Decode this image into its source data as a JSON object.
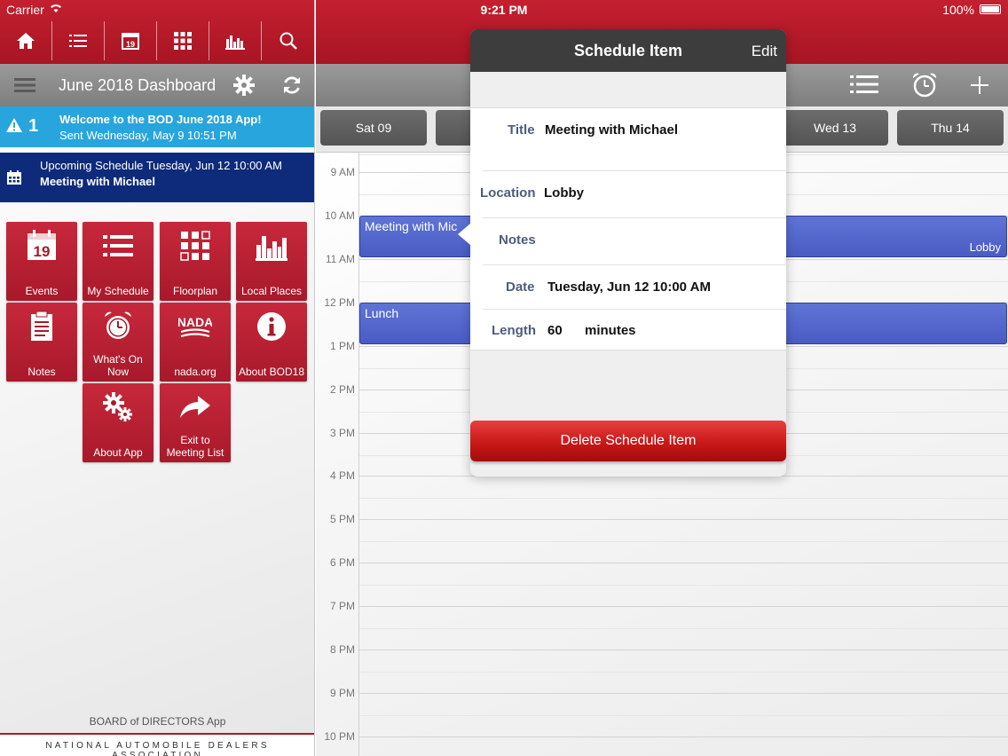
{
  "status_bar": {
    "carrier": "Carrier",
    "time": "9:21 PM",
    "battery": "100%"
  },
  "toolbar": {
    "icons": [
      "home-icon",
      "list-icon",
      "calendar-icon",
      "floorplan-grid-icon",
      "city-skyline-icon",
      "search-icon"
    ]
  },
  "dashboard": {
    "title": "June 2018 Dashboard"
  },
  "notification": {
    "count": "1",
    "title": "Welcome to the BOD June 2018 App!",
    "sent": "Sent Wednesday, May 9 10:51 PM"
  },
  "upcoming": {
    "line1": "Upcoming Schedule Tuesday, Jun 12 10:00 AM",
    "line2": "Meeting with Michael"
  },
  "tiles": {
    "events": "Events",
    "my_schedule": "My Schedule",
    "floorplan": "Floorplan",
    "local_places": "Local Places",
    "notes": "Notes",
    "whats_on_now": "What's On Now",
    "nada_org": "nada.org",
    "about_bod": "About BOD18",
    "about_app": "About App",
    "exit": "Exit to Meeting List",
    "calendar_day": "19",
    "nada_logo": "NADA"
  },
  "footer": {
    "app_name": "BOARD of DIRECTORS App",
    "org": "NATIONAL AUTOMOBILE DEALERS ASSOCIATION"
  },
  "days": [
    "Sat 09",
    "",
    "Wed 13",
    "Thu 14"
  ],
  "hours": [
    "9 AM",
    "10 AM",
    "11 AM",
    "12 PM",
    "1 PM",
    "2 PM",
    "3 PM",
    "4 PM",
    "5 PM",
    "6 PM",
    "7 PM",
    "8 PM",
    "9 PM",
    "10 PM"
  ],
  "events": [
    {
      "name": "Meeting with Mic",
      "location": "Lobby"
    },
    {
      "name": "Lunch",
      "location": ""
    }
  ],
  "popover": {
    "title": "Schedule Item",
    "edit": "Edit",
    "fields": {
      "title_label": "Title",
      "title_value": "Meeting with Michael",
      "location_label": "Location",
      "location_value": "Lobby",
      "notes_label": "Notes",
      "notes_value": "",
      "date_label": "Date",
      "date_value": "Tuesday, Jun 12 10:00 AM",
      "length_label": "Length",
      "length_value": "60",
      "length_unit": "minutes"
    },
    "delete": "Delete Schedule Item"
  },
  "colors": {
    "brand_red": "#b71c2c",
    "notice_blue": "#28a5dc",
    "upcoming_navy": "#0d2b7a",
    "event_blue": "#5468cc"
  }
}
